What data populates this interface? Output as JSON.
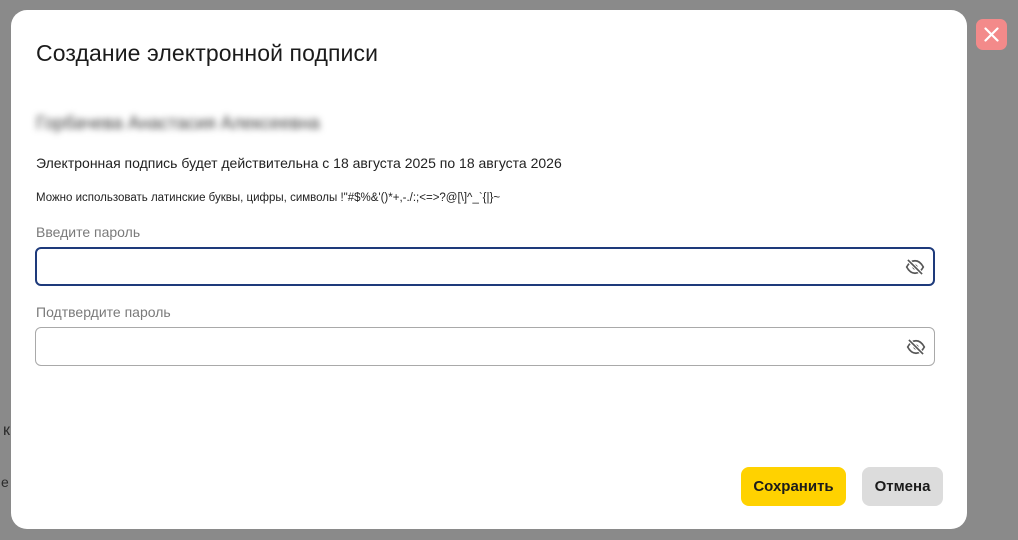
{
  "background": {
    "fragment_1": "к",
    "fragment_2": "е"
  },
  "dialog": {
    "title": "Создание электронной подписи",
    "holder_name": "Горбачева Анастасия Алексеевна",
    "validity_text": "Электронная подпись будет действительна с 18 августа 2025 по 18 августа 2026",
    "hint_text": "Можно использовать латинские буквы, цифры, символы !\"#$%&'()*+,-./:;<=>?@[\\]^_`{|}~",
    "password": {
      "label": "Введите пароль",
      "value": "",
      "toggle_icon": "eye-off-icon"
    },
    "confirm_password": {
      "label": "Подтвердите пароль",
      "value": "",
      "toggle_icon": "eye-off-icon"
    },
    "buttons": {
      "save_label": "Сохранить",
      "cancel_label": "Отмена"
    },
    "close_icon": "close-icon"
  },
  "colors": {
    "backdrop": "#8a8a8a",
    "accent_save": "#ffd200",
    "cancel": "#dcdcdc",
    "focus_border": "#1e3a7b",
    "close": "#f38a8a"
  }
}
